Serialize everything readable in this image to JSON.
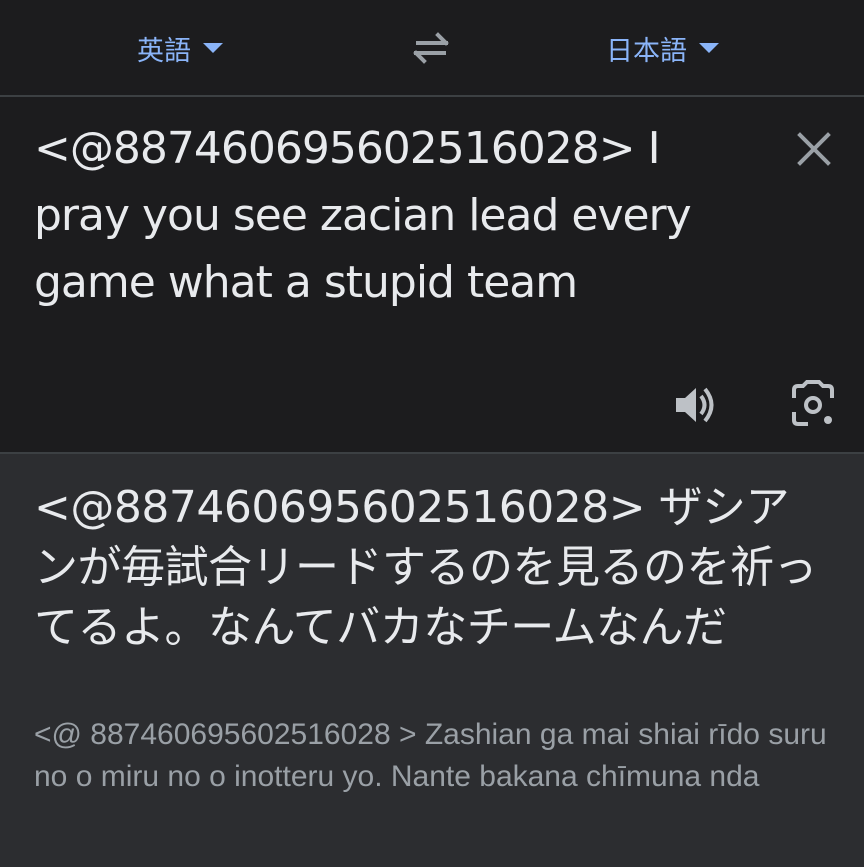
{
  "language_bar": {
    "source_language": "英語",
    "target_language": "日本語",
    "swap_icon": "swap-arrows-icon"
  },
  "source": {
    "text": "<@887460695602516028> I pray you see zacian lead every game what a stupid team",
    "clear_icon": "close-icon",
    "speaker_icon": "speaker-icon",
    "lens_icon": "camera-lens-icon"
  },
  "result": {
    "translation": "<@887460695602516028> ザシアンが毎試合リードするのを見るのを祈ってるよ。なんてバカなチームなんだ",
    "transliteration": "<@ 887460695602516028 > Zashian ga mai shiai rīdo suru no o miru no o inotteru yo. Nante bakana chīmuna nda"
  },
  "colors": {
    "background": "#202124",
    "panel": "#1c1c1e",
    "result_panel": "#2c2d30",
    "accent": "#8ab4f8",
    "text_primary": "#e8eaed",
    "text_secondary": "#9aa0a6"
  }
}
